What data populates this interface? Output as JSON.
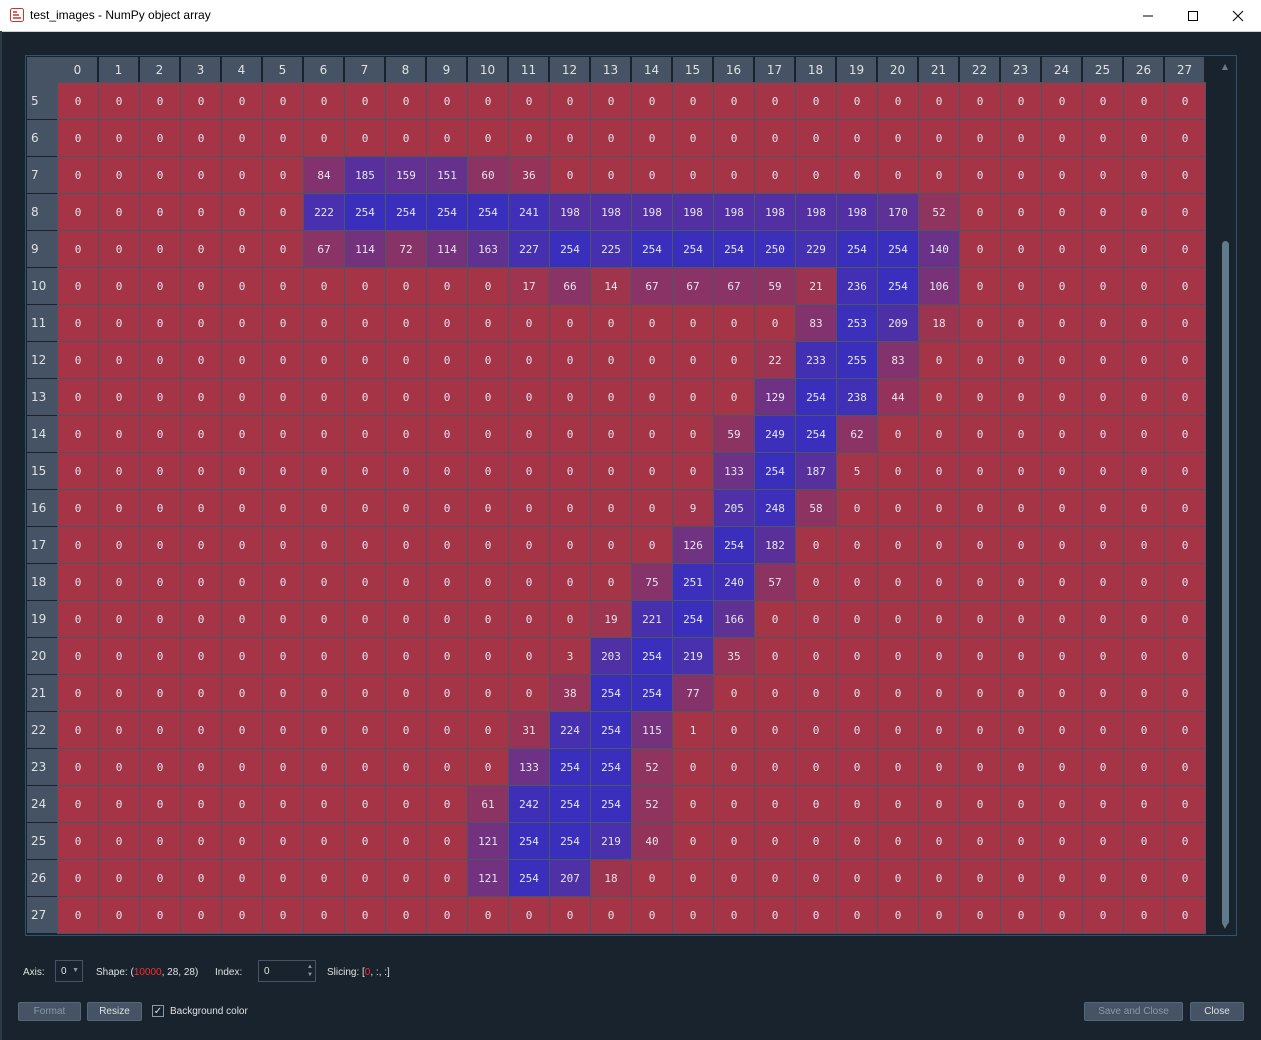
{
  "window": {
    "title": "test_images - NumPy object array",
    "minimize_glyph": "—",
    "maximize_glyph": "☐",
    "close_glyph": "✕"
  },
  "table": {
    "columns": [
      "0",
      "1",
      "2",
      "3",
      "4",
      "5",
      "6",
      "7",
      "8",
      "9",
      "10",
      "11",
      "12",
      "13",
      "14",
      "15",
      "16",
      "17",
      "18",
      "19",
      "20",
      "21",
      "22",
      "23",
      "24",
      "25",
      "26",
      "27"
    ],
    "rows": [
      {
        "label": "5",
        "values": [
          0,
          0,
          0,
          0,
          0,
          0,
          0,
          0,
          0,
          0,
          0,
          0,
          0,
          0,
          0,
          0,
          0,
          0,
          0,
          0,
          0,
          0,
          0,
          0,
          0,
          0,
          0,
          0
        ]
      },
      {
        "label": "6",
        "values": [
          0,
          0,
          0,
          0,
          0,
          0,
          0,
          0,
          0,
          0,
          0,
          0,
          0,
          0,
          0,
          0,
          0,
          0,
          0,
          0,
          0,
          0,
          0,
          0,
          0,
          0,
          0,
          0
        ]
      },
      {
        "label": "7",
        "values": [
          0,
          0,
          0,
          0,
          0,
          0,
          84,
          185,
          159,
          151,
          60,
          36,
          0,
          0,
          0,
          0,
          0,
          0,
          0,
          0,
          0,
          0,
          0,
          0,
          0,
          0,
          0,
          0
        ]
      },
      {
        "label": "8",
        "values": [
          0,
          0,
          0,
          0,
          0,
          0,
          222,
          254,
          254,
          254,
          254,
          241,
          198,
          198,
          198,
          198,
          198,
          198,
          198,
          198,
          170,
          52,
          0,
          0,
          0,
          0,
          0,
          0
        ]
      },
      {
        "label": "9",
        "values": [
          0,
          0,
          0,
          0,
          0,
          0,
          67,
          114,
          72,
          114,
          163,
          227,
          254,
          225,
          254,
          254,
          254,
          250,
          229,
          254,
          254,
          140,
          0,
          0,
          0,
          0,
          0,
          0
        ]
      },
      {
        "label": "10",
        "values": [
          0,
          0,
          0,
          0,
          0,
          0,
          0,
          0,
          0,
          0,
          0,
          17,
          66,
          14,
          67,
          67,
          67,
          59,
          21,
          236,
          254,
          106,
          0,
          0,
          0,
          0,
          0,
          0
        ]
      },
      {
        "label": "11",
        "values": [
          0,
          0,
          0,
          0,
          0,
          0,
          0,
          0,
          0,
          0,
          0,
          0,
          0,
          0,
          0,
          0,
          0,
          0,
          83,
          253,
          209,
          18,
          0,
          0,
          0,
          0,
          0,
          0
        ]
      },
      {
        "label": "12",
        "values": [
          0,
          0,
          0,
          0,
          0,
          0,
          0,
          0,
          0,
          0,
          0,
          0,
          0,
          0,
          0,
          0,
          0,
          22,
          233,
          255,
          83,
          0,
          0,
          0,
          0,
          0,
          0,
          0
        ]
      },
      {
        "label": "13",
        "values": [
          0,
          0,
          0,
          0,
          0,
          0,
          0,
          0,
          0,
          0,
          0,
          0,
          0,
          0,
          0,
          0,
          0,
          129,
          254,
          238,
          44,
          0,
          0,
          0,
          0,
          0,
          0,
          0
        ]
      },
      {
        "label": "14",
        "values": [
          0,
          0,
          0,
          0,
          0,
          0,
          0,
          0,
          0,
          0,
          0,
          0,
          0,
          0,
          0,
          0,
          59,
          249,
          254,
          62,
          0,
          0,
          0,
          0,
          0,
          0,
          0,
          0
        ]
      },
      {
        "label": "15",
        "values": [
          0,
          0,
          0,
          0,
          0,
          0,
          0,
          0,
          0,
          0,
          0,
          0,
          0,
          0,
          0,
          0,
          133,
          254,
          187,
          5,
          0,
          0,
          0,
          0,
          0,
          0,
          0,
          0
        ]
      },
      {
        "label": "16",
        "values": [
          0,
          0,
          0,
          0,
          0,
          0,
          0,
          0,
          0,
          0,
          0,
          0,
          0,
          0,
          0,
          9,
          205,
          248,
          58,
          0,
          0,
          0,
          0,
          0,
          0,
          0,
          0,
          0
        ]
      },
      {
        "label": "17",
        "values": [
          0,
          0,
          0,
          0,
          0,
          0,
          0,
          0,
          0,
          0,
          0,
          0,
          0,
          0,
          0,
          126,
          254,
          182,
          0,
          0,
          0,
          0,
          0,
          0,
          0,
          0,
          0,
          0
        ]
      },
      {
        "label": "18",
        "values": [
          0,
          0,
          0,
          0,
          0,
          0,
          0,
          0,
          0,
          0,
          0,
          0,
          0,
          0,
          75,
          251,
          240,
          57,
          0,
          0,
          0,
          0,
          0,
          0,
          0,
          0,
          0,
          0
        ]
      },
      {
        "label": "19",
        "values": [
          0,
          0,
          0,
          0,
          0,
          0,
          0,
          0,
          0,
          0,
          0,
          0,
          0,
          19,
          221,
          254,
          166,
          0,
          0,
          0,
          0,
          0,
          0,
          0,
          0,
          0,
          0,
          0
        ]
      },
      {
        "label": "20",
        "values": [
          0,
          0,
          0,
          0,
          0,
          0,
          0,
          0,
          0,
          0,
          0,
          0,
          3,
          203,
          254,
          219,
          35,
          0,
          0,
          0,
          0,
          0,
          0,
          0,
          0,
          0,
          0,
          0
        ]
      },
      {
        "label": "21",
        "values": [
          0,
          0,
          0,
          0,
          0,
          0,
          0,
          0,
          0,
          0,
          0,
          0,
          38,
          254,
          254,
          77,
          0,
          0,
          0,
          0,
          0,
          0,
          0,
          0,
          0,
          0,
          0,
          0
        ]
      },
      {
        "label": "22",
        "values": [
          0,
          0,
          0,
          0,
          0,
          0,
          0,
          0,
          0,
          0,
          0,
          31,
          224,
          254,
          115,
          1,
          0,
          0,
          0,
          0,
          0,
          0,
          0,
          0,
          0,
          0,
          0,
          0
        ]
      },
      {
        "label": "23",
        "values": [
          0,
          0,
          0,
          0,
          0,
          0,
          0,
          0,
          0,
          0,
          0,
          133,
          254,
          254,
          52,
          0,
          0,
          0,
          0,
          0,
          0,
          0,
          0,
          0,
          0,
          0,
          0,
          0
        ]
      },
      {
        "label": "24",
        "values": [
          0,
          0,
          0,
          0,
          0,
          0,
          0,
          0,
          0,
          0,
          61,
          242,
          254,
          254,
          52,
          0,
          0,
          0,
          0,
          0,
          0,
          0,
          0,
          0,
          0,
          0,
          0,
          0
        ]
      },
      {
        "label": "25",
        "values": [
          0,
          0,
          0,
          0,
          0,
          0,
          0,
          0,
          0,
          0,
          121,
          254,
          254,
          219,
          40,
          0,
          0,
          0,
          0,
          0,
          0,
          0,
          0,
          0,
          0,
          0,
          0,
          0
        ]
      },
      {
        "label": "26",
        "values": [
          0,
          0,
          0,
          0,
          0,
          0,
          0,
          0,
          0,
          0,
          121,
          254,
          207,
          18,
          0,
          0,
          0,
          0,
          0,
          0,
          0,
          0,
          0,
          0,
          0,
          0,
          0,
          0
        ]
      },
      {
        "label": "27",
        "values": [
          0,
          0,
          0,
          0,
          0,
          0,
          0,
          0,
          0,
          0,
          0,
          0,
          0,
          0,
          0,
          0,
          0,
          0,
          0,
          0,
          0,
          0,
          0,
          0,
          0,
          0,
          0,
          0
        ]
      }
    ],
    "background_color_low": "#a53447",
    "background_color_high": "#3a2fbd",
    "value_max": 255
  },
  "controls": {
    "axis_label": "Axis:",
    "axis_value": "0",
    "shape_label": "Shape: (",
    "shape_first": "10000",
    "shape_rest": ", 28, 28)",
    "index_label": "Index:",
    "index_value": "0",
    "slicing_label": "Slicing: [",
    "slicing_first": "0",
    "slicing_rest": ", :, :]"
  },
  "buttons": {
    "format": "Format",
    "resize": "Resize",
    "background_color": "Background color",
    "background_color_checked": true,
    "save_and_close": "Save and Close",
    "close": "Close"
  },
  "colors": {
    "window_bg": "#19232d",
    "header_bg": "#455364",
    "highlight_red": "#ff2a2a"
  }
}
